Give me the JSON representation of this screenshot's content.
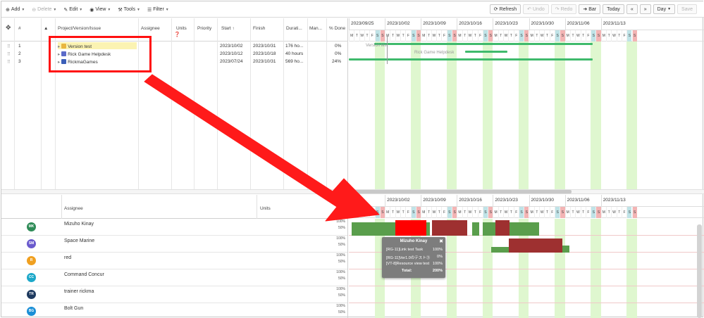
{
  "toolbar": {
    "add": "Add",
    "delete": "Delete",
    "edit": "Edit",
    "view": "View",
    "tools": "Tools",
    "filter": "Filter",
    "refresh": "Refresh",
    "undo": "Undo",
    "redo": "Redo",
    "bar": "Bar",
    "today": "Today",
    "prev": "«",
    "next": "»",
    "day": "Day",
    "save": "Save"
  },
  "grid": {
    "headers": {
      "num": "#",
      "project": "Project/Version/Issue",
      "assignee": "Assignee",
      "units": "Units",
      "priority": "Priority",
      "start": "Start ↑",
      "finish": "Finish",
      "duration": "Durati...",
      "manual": "Man...",
      "done": "% Done"
    },
    "rows": [
      {
        "num": "1",
        "name": "Version test",
        "start": "2023/10/02",
        "finish": "2023/10/31",
        "duration": "176 ho...",
        "done": "0%"
      },
      {
        "num": "2",
        "name": "Rick Game Helpdesk",
        "start": "2023/10/12",
        "finish": "2023/10/18",
        "duration": "40 hours",
        "done": "0%"
      },
      {
        "num": "3",
        "name": "RickmaGames",
        "start": "2023/07/24",
        "finish": "2023/10/31",
        "duration": "569 ho...",
        "done": "24%"
      }
    ]
  },
  "gantt": {
    "weeks": [
      "2023/09/25",
      "2023/10/02",
      "2023/10/09",
      "2023/10/16",
      "2023/10/23",
      "2023/10/30",
      "2023/11/06",
      "2023/11/13"
    ],
    "bottom_weeks": [
      "09/25",
      "2023/10/02",
      "2023/10/09",
      "2023/10/16",
      "2023/10/23",
      "2023/10/30",
      "2023/11/06",
      "2023/11/13"
    ],
    "days": [
      "M",
      "T",
      "W",
      "T",
      "F",
      "S",
      "S"
    ],
    "bar_labels": {
      "version": "Version test",
      "helpdesk": "Rick Game Helpdesk"
    }
  },
  "resources": {
    "headers": {
      "assignee": "Assignee",
      "units": "Units"
    },
    "pct_100": "100%",
    "pct_50": "50%",
    "rows": [
      {
        "initials": "MK",
        "name": "Mizuho Kinay",
        "color": "#2e8b57"
      },
      {
        "initials": "SM",
        "name": "Space Marine",
        "color": "#6a5acd"
      },
      {
        "initials": "R",
        "name": "red",
        "color": "#f0a020"
      },
      {
        "initials": "CC",
        "name": "Command Concur",
        "color": "#1ca8c9"
      },
      {
        "initials": "TR",
        "name": "trainer rickma",
        "color": "#1e3a5f"
      },
      {
        "initials": "BG",
        "name": "Bolt Gun",
        "color": "#1a8fd6"
      }
    ]
  },
  "tooltip": {
    "title": "Mizuho Kinay",
    "lines": [
      {
        "label": "[RG-11]Link test Task",
        "value": "100%"
      },
      {
        "label": "[RG-11]Ver1.0のテスト③",
        "value": "0%"
      },
      {
        "label": "[VT-8]Resource view test",
        "value": "100%"
      },
      {
        "label": "Total:",
        "value": "200%"
      }
    ]
  },
  "colors": {
    "accent_green": "#3fba6c",
    "overload_red": "#ff0000",
    "load_green": "#5a9e4c",
    "load_dark_red": "#9e3030",
    "weekend_green": "#dff7cf"
  }
}
